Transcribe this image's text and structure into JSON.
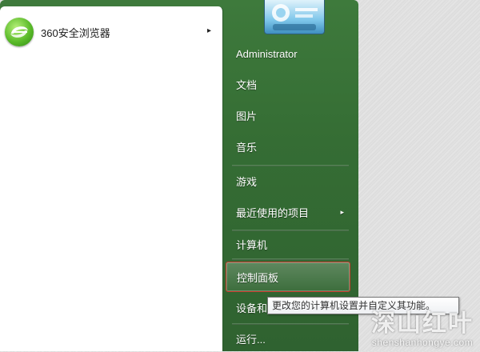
{
  "program_list": {
    "items": [
      {
        "label": "360安全浏览器",
        "icon": "360-browser-icon",
        "has_submenu": true
      }
    ]
  },
  "user_tile": {
    "icon": "user-picture-icon"
  },
  "right_pane": {
    "items": [
      {
        "id": "administrator",
        "label": "Administrator"
      },
      {
        "id": "documents",
        "label": "文档"
      },
      {
        "id": "pictures",
        "label": "图片"
      },
      {
        "id": "music",
        "label": "音乐"
      },
      {
        "id": "games",
        "label": "游戏"
      },
      {
        "id": "recent-items",
        "label": "最近使用的项目",
        "has_submenu": true
      },
      {
        "id": "computer",
        "label": "计算机"
      },
      {
        "id": "control-panel",
        "label": "控制面板",
        "highlighted": true
      },
      {
        "id": "devices-printers",
        "label": "设备和"
      },
      {
        "id": "run",
        "label": "运行..."
      }
    ],
    "submenu_arrow": "▸"
  },
  "tooltip": {
    "text": "更改您的计算机设置并自定义其功能。"
  },
  "watermark": {
    "cn": "深山红叶",
    "en": "shenshanhongye.com"
  },
  "colors": {
    "menu_green": "#3e7a3c",
    "highlight_border": "#c9392b"
  }
}
